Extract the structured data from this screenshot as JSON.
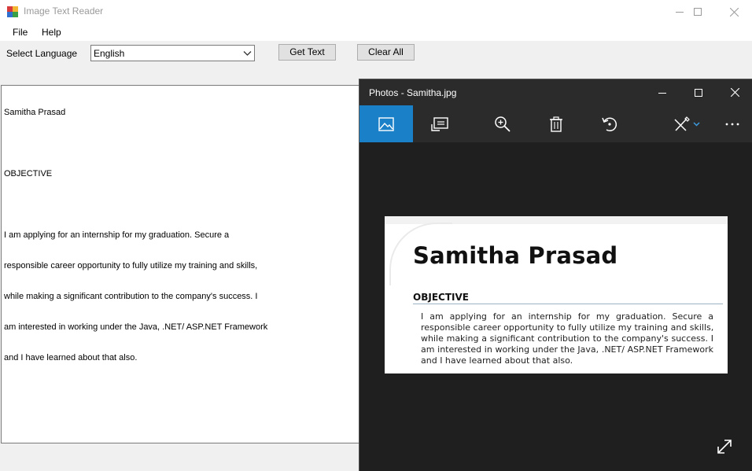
{
  "app": {
    "title": "Image Text Reader",
    "menu": [
      "File",
      "Help"
    ]
  },
  "controls": {
    "language_label": "Select Language",
    "language_value": "English",
    "get_text_label": "Get Text",
    "clear_all_label": "Clear All"
  },
  "output_text": {
    "lines": [
      "Samitha Prasad",
      "",
      "OBJECTIVE",
      "",
      "I am applying for an internship for my graduation. Secure a",
      "responsible career opportunity to fully utilize my training and skills,",
      "while making a significant contribution to the company's success. I",
      "am interested in working under the Java, .NET/ ASP.NET Framework",
      "and I have learned about that also."
    ]
  },
  "photos": {
    "title": "Photos - Samitha.jpg",
    "toolbar_icons": [
      "image-icon",
      "slideshow-icon",
      "zoom-icon",
      "delete-icon",
      "rotate-icon",
      "edit-icon",
      "more-icon"
    ],
    "accent": "#1a80c8",
    "document": {
      "name": "Samitha Prasad",
      "heading": "OBJECTIVE",
      "body_lines": [
        "I am applying for an internship for my graduation. Secure a",
        "responsible career opportunity to fully utilize my training and skills,",
        "while making a significant contribution to the company's success. I",
        "am interested in working under the Java, .NET/ ASP.NET Framework",
        "and I have learned about that also."
      ]
    }
  }
}
